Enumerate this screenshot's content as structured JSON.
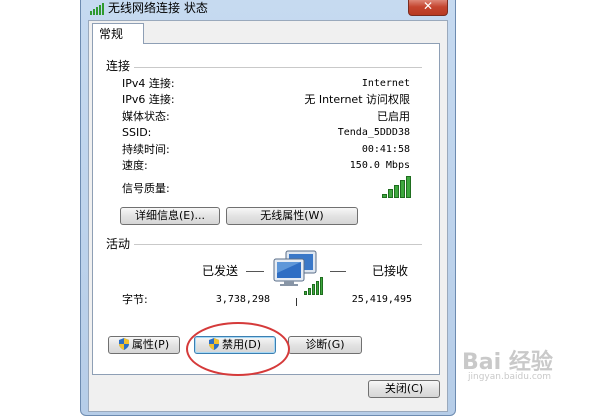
{
  "window": {
    "title": "无线网络连接 状态",
    "close_glyph": "✕"
  },
  "tabs": [
    {
      "label": "常规"
    }
  ],
  "connection": {
    "group_label": "连接",
    "rows": [
      {
        "label": "IPv4 连接:",
        "value": "Internet"
      },
      {
        "label": "IPv6 连接:",
        "value": "无 Internet 访问权限"
      },
      {
        "label": "媒体状态:",
        "value": "已启用"
      },
      {
        "label": "SSID:",
        "value": "Tenda_5DDD38"
      },
      {
        "label": "持续时间:",
        "value": "00:41:58"
      },
      {
        "label": "速度:",
        "value": "150.0 Mbps"
      }
    ],
    "signal_label": "信号质量:",
    "signal_bars_filled": 5,
    "signal_bars_total": 5,
    "details_button": "详细信息(E)...",
    "wireless_props_button": "无线属性(W)"
  },
  "activity": {
    "group_label": "活动",
    "sent_label": "已发送",
    "received_label": "已接收",
    "bytes_label": "字节:",
    "bytes_sent": "3,738,298",
    "bytes_received": "25,419,495"
  },
  "actions": {
    "properties_button": "属性(P)",
    "disable_button": "禁用(D)",
    "diagnose_button": "诊断(G)",
    "close_button": "关闭(C)"
  },
  "watermark": {
    "text": "Bai 经验",
    "sub": "jingyan.baidu.com"
  },
  "colors": {
    "signal_green": "#3ea83e",
    "highlight_circle": "#d53a3a"
  }
}
